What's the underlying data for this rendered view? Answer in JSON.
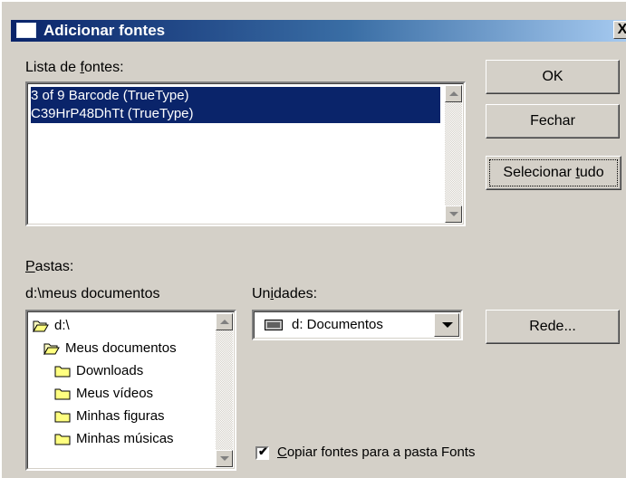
{
  "window": {
    "title": "Adicionar fontes",
    "close_label": "X"
  },
  "font_list": {
    "label_prefix": "Lista de ",
    "label_underlined": "f",
    "label_suffix": "ontes:",
    "items": [
      {
        "label": "3 of 9 Barcode (TrueType)",
        "selected": true
      },
      {
        "label": "C39HrP48DhTt (TrueType)",
        "selected": true
      }
    ]
  },
  "buttons": {
    "ok": "OK",
    "close": "Fechar",
    "select_all_prefix": "Selecionar ",
    "select_all_underlined": "t",
    "select_all_suffix": "udo",
    "network": "Rede..."
  },
  "folders": {
    "label_underlined": "P",
    "label_suffix": "astas:",
    "current_path": "d:\\meus documentos",
    "items": [
      {
        "label": "d:\\",
        "icon": "open-folder-icon",
        "indent": 0
      },
      {
        "label": "Meus documentos",
        "icon": "open-folder-icon",
        "indent": 1
      },
      {
        "label": "Downloads",
        "icon": "folder-icon",
        "indent": 2
      },
      {
        "label": "Meus vídeos",
        "icon": "folder-icon",
        "indent": 2
      },
      {
        "label": "Minhas figuras",
        "icon": "folder-icon",
        "indent": 2
      },
      {
        "label": "Minhas músicas",
        "icon": "folder-icon",
        "indent": 2
      }
    ]
  },
  "drives": {
    "label_prefix": "Un",
    "label_underlined": "i",
    "label_suffix": "dades:",
    "selected": "d: Documentos",
    "icon": "drive-icon"
  },
  "copy_option": {
    "checked": true,
    "label_underlined": "C",
    "label_suffix": "opiar fontes para a pasta Fonts"
  },
  "colors": {
    "selection": "#0a246a",
    "title_bar": "#0a246a",
    "dialog_face": "#d4d0c8"
  }
}
